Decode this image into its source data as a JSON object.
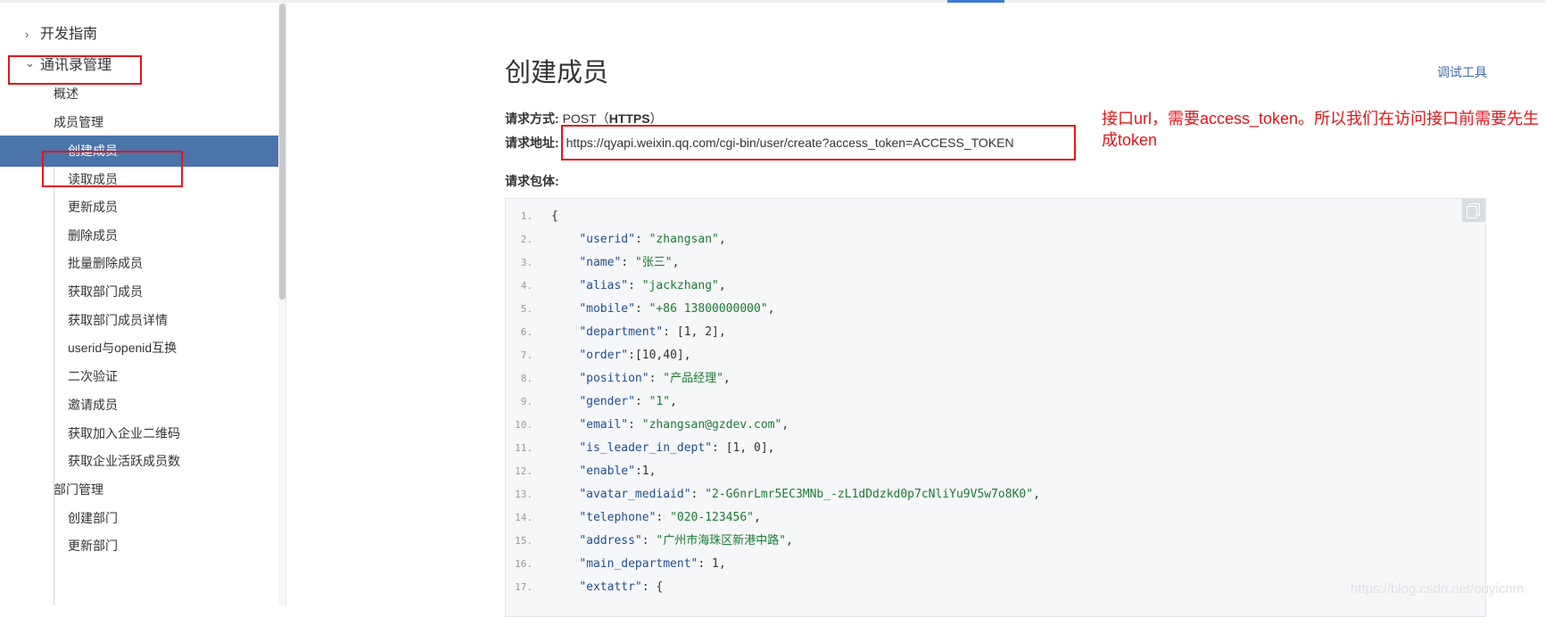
{
  "sidebar": {
    "items": [
      {
        "label": "开发指南",
        "caret": "›",
        "level": 0
      },
      {
        "label": "通讯录管理",
        "caret": "⌄",
        "level": 0
      },
      {
        "label": "概述",
        "level": 1
      },
      {
        "label": "成员管理",
        "level": 1
      },
      {
        "label": "创建成员",
        "level": 2,
        "active": true
      },
      {
        "label": "读取成员",
        "level": 2
      },
      {
        "label": "更新成员",
        "level": 2
      },
      {
        "label": "删除成员",
        "level": 2
      },
      {
        "label": "批量删除成员",
        "level": 2
      },
      {
        "label": "获取部门成员",
        "level": 2
      },
      {
        "label": "获取部门成员详情",
        "level": 2
      },
      {
        "label": "userid与openid互换",
        "level": 2
      },
      {
        "label": "二次验证",
        "level": 2
      },
      {
        "label": "邀请成员",
        "level": 2
      },
      {
        "label": "获取加入企业二维码",
        "level": 2
      },
      {
        "label": "获取企业活跃成员数",
        "level": 2
      },
      {
        "label": "部门管理",
        "level": 1
      },
      {
        "label": "创建部门",
        "level": 2
      },
      {
        "label": "更新部门",
        "level": 2
      }
    ]
  },
  "main": {
    "title": "创建成员",
    "debug_tool": "调试工具",
    "request_method_label": "请求方式:",
    "request_method_value": "POST（",
    "request_method_bold": "HTTPS",
    "request_method_close": "）",
    "request_url_label": "请求地址:",
    "request_url_value": "https://qyapi.weixin.qq.com/cgi-bin/user/create?access_token=ACCESS_TOKEN",
    "request_body_label": "请求包体:"
  },
  "annotation": {
    "note": "接口url，需要access_token。所以我们在访问接口前需要先生成token"
  },
  "code_lines": [
    {
      "n": "1.",
      "indent": "",
      "key": "",
      "sep": "",
      "val": "{",
      "tail": ""
    },
    {
      "n": "2.",
      "indent": "    ",
      "key": "\"userid\"",
      "sep": ": ",
      "val": "\"zhangsan\"",
      "tail": ","
    },
    {
      "n": "3.",
      "indent": "    ",
      "key": "\"name\"",
      "sep": ": ",
      "val": "\"张三\"",
      "tail": ","
    },
    {
      "n": "4.",
      "indent": "    ",
      "key": "\"alias\"",
      "sep": ": ",
      "val": "\"jackzhang\"",
      "tail": ","
    },
    {
      "n": "5.",
      "indent": "    ",
      "key": "\"mobile\"",
      "sep": ": ",
      "val": "\"+86 13800000000\"",
      "tail": ","
    },
    {
      "n": "6.",
      "indent": "    ",
      "key": "\"department\"",
      "sep": ": ",
      "val": "[1, 2]",
      "tail": ","
    },
    {
      "n": "7.",
      "indent": "    ",
      "key": "\"order\"",
      "sep": ":",
      "val": "[10,40]",
      "tail": ","
    },
    {
      "n": "8.",
      "indent": "    ",
      "key": "\"position\"",
      "sep": ": ",
      "val": "\"产品经理\"",
      "tail": ","
    },
    {
      "n": "9.",
      "indent": "    ",
      "key": "\"gender\"",
      "sep": ": ",
      "val": "\"1\"",
      "tail": ","
    },
    {
      "n": "10.",
      "indent": "    ",
      "key": "\"email\"",
      "sep": ": ",
      "val": "\"zhangsan@gzdev.com\"",
      "tail": ","
    },
    {
      "n": "11.",
      "indent": "    ",
      "key": "\"is_leader_in_dept\"",
      "sep": ": ",
      "val": "[1, 0]",
      "tail": ","
    },
    {
      "n": "12.",
      "indent": "    ",
      "key": "\"enable\"",
      "sep": ":",
      "val": "1",
      "tail": ","
    },
    {
      "n": "13.",
      "indent": "    ",
      "key": "\"avatar_mediaid\"",
      "sep": ": ",
      "val": "\"2-G6nrLmr5EC3MNb_-zL1dDdzkd0p7cNliYu9V5w7o8K0\"",
      "tail": ","
    },
    {
      "n": "14.",
      "indent": "    ",
      "key": "\"telephone\"",
      "sep": ": ",
      "val": "\"020-123456\"",
      "tail": ","
    },
    {
      "n": "15.",
      "indent": "    ",
      "key": "\"address\"",
      "sep": ": ",
      "val": "\"广州市海珠区新港中路\"",
      "tail": ","
    },
    {
      "n": "16.",
      "indent": "    ",
      "key": "\"main_department\"",
      "sep": ": ",
      "val": "1",
      "tail": ","
    },
    {
      "n": "17.",
      "indent": "    ",
      "key": "\"extattr\"",
      "sep": ": ",
      "val": "{",
      "tail": ""
    }
  ],
  "watermark": "https://blog.csdn.net/ouyicnm",
  "colors": {
    "active_bg": "#4a74aa",
    "highlight_red": "#e0161b",
    "link_blue": "#3d6ca8"
  }
}
